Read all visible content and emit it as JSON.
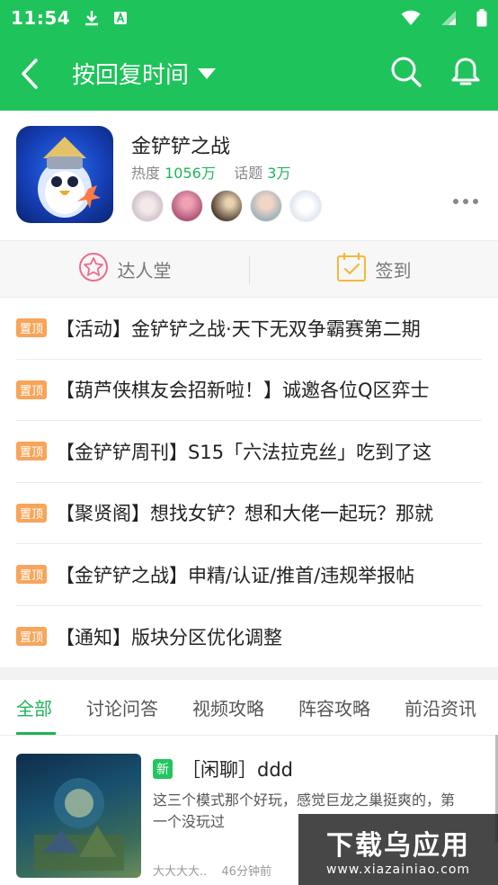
{
  "status": {
    "time": "11:54"
  },
  "header": {
    "title": "按回复时间"
  },
  "game": {
    "name": "金铲铲之战",
    "heat_label": "热度",
    "heat_value": "1056万",
    "topic_label": "话题",
    "topic_value": "3万"
  },
  "quick": {
    "hall_label": "达人堂",
    "checkin_label": "签到"
  },
  "pinned": [
    {
      "tag": "置顶",
      "text": "【活动】金铲铲之战·天下无双争霸赛第二期"
    },
    {
      "tag": "置顶",
      "text": "【葫芦侠棋友会招新啦！】诚邀各位Q区弈士"
    },
    {
      "tag": "置顶",
      "text": "【金铲铲周刊】S15「六法拉克丝」吃到了这"
    },
    {
      "tag": "置顶",
      "text": "【聚贤阁】想找女铲？想和大佬一起玩？那就"
    },
    {
      "tag": "置顶",
      "text": "【金铲铲之战】申精/认证/推首/违规举报帖"
    },
    {
      "tag": "置顶",
      "text": "【通知】版块分区优化调整"
    }
  ],
  "categories": [
    "全部",
    "讨论问答",
    "视频攻略",
    "阵容攻略",
    "前沿资讯"
  ],
  "post": {
    "badge": "新",
    "title": "［闲聊］ddd",
    "excerpt": "这三个模式那个好玩，感觉巨龙之巢挺爽的，第一个没玩过",
    "author": "大大大大..",
    "time": "46分钟前"
  },
  "watermark": {
    "main": "下载乌应用",
    "sub": "www.xiazainiao.com"
  },
  "colors": {
    "brand": "#1fc35b",
    "accent_text": "#1fb457",
    "pin_tag": "#f7a55a"
  }
}
